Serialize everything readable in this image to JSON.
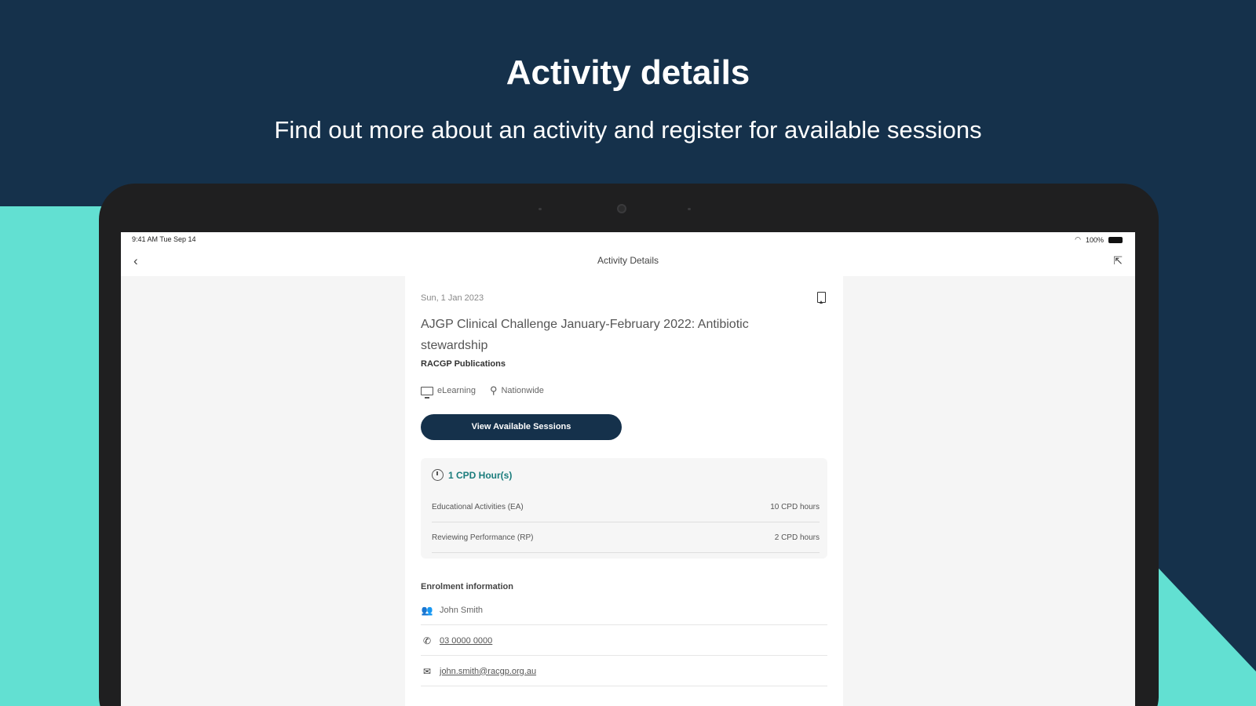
{
  "hero": {
    "title": "Activity details",
    "subtitle": "Find out more about an activity and register for available sessions"
  },
  "status_bar": {
    "time": "9:41 AM   Tue Sep 14",
    "battery": "100%"
  },
  "nav": {
    "title": "Activity Details"
  },
  "activity": {
    "date": "Sun, 1 Jan 2023",
    "title": "AJGP Clinical Challenge January-February 2022: Antibiotic stewardship",
    "provider": "RACGP Publications",
    "format": "eLearning",
    "location": "Nationwide",
    "button_label": "View Available Sessions"
  },
  "cpd": {
    "hours_label": "1 CPD Hour(s)",
    "rows": [
      {
        "label": "Educational Activities (EA)",
        "value": "10 CPD hours"
      },
      {
        "label": "Reviewing Performance (RP)",
        "value": "2 CPD hours"
      }
    ]
  },
  "enrolment": {
    "title": "Enrolment information",
    "name": "John Smith",
    "phone": "03 0000 0000",
    "email": "john.smith@racgp.org.au"
  },
  "colors": {
    "navy": "#15314b",
    "teal": "#62e0d2",
    "cpd_accent": "#1a7c7c"
  }
}
